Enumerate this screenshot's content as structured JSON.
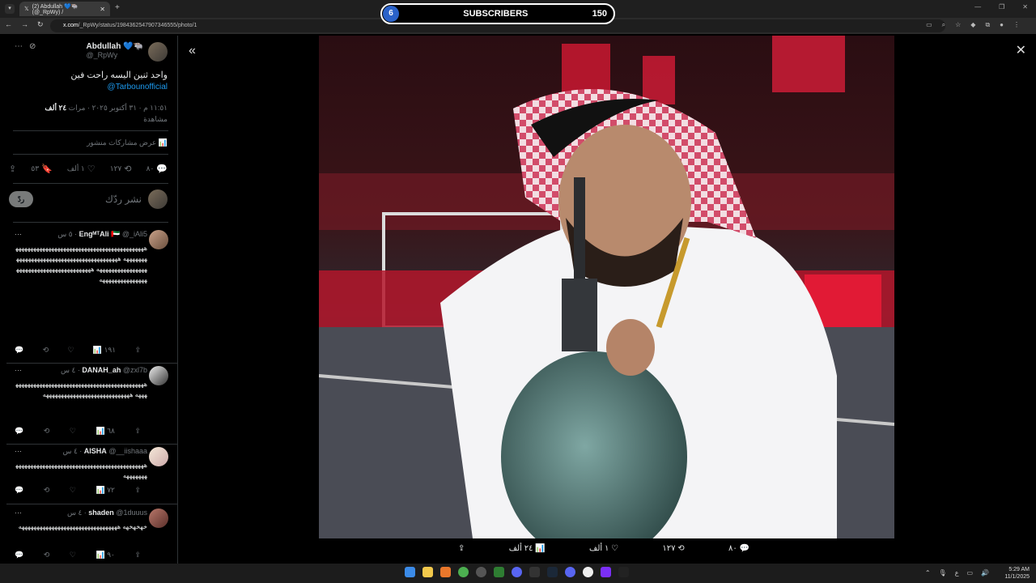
{
  "browser": {
    "tab_title": "(2) Abdullah 💙🐃 (@_RpWy) /",
    "tab_menu_icon": "chevron-down-icon",
    "new_tab": "+",
    "url_host": "x.com",
    "url_path": "/_RpWy/status/1984362547907346555/photo/1"
  },
  "overlay": {
    "count": "6",
    "label": "SUBSCRIBERS",
    "goal": "150",
    "accent": "#2a62c9"
  },
  "post": {
    "author": "Abdullah 💙🐃",
    "handle": "@_RpWy",
    "text": "واحد ثنين اليسه راحت فين",
    "mention": "@Tarbounofficial",
    "time_line": "١١:٥١ م · ٣١ أكتوبر ٢٠٢٥ · مرات",
    "views_count": "٢٤ ألف",
    "views_label": "مشاهدة",
    "engagements": "عرض مشاركات منشور",
    "actions": {
      "replies": "٨٠",
      "reposts": "١٢٧",
      "likes": "١ ألف",
      "bookmarks": "٥٣"
    },
    "reply_placeholder": "نشر ردّك",
    "reply_button": "ردّ"
  },
  "comments": [
    {
      "name": "EngᴹᵀAli 🇦🇪",
      "handle": "@_iAli5",
      "time": "٥ س",
      "text": "هههههههههههههههههههههههههههههههههههههههههههههههههههه هههههههههههههههههههههههههههههههههههههههههههههههههههه هههههههههههههههههههههههههههههههههههههههههه",
      "views": "١٩١"
    },
    {
      "name": "DANAH_ah",
      "handle": "@zxl7b",
      "time": "٤ س",
      "text": "هههههههههههههههههههههههههههههههههههههههههههههههه هههههههههههههههههههههههههههههه",
      "views": "٦٨"
    },
    {
      "name": "AISHA",
      "handle": "@__iishaaa",
      "time": "٤ س",
      "text": "هههههههههههههههههههههههههههههههههههههههههههههههههههه",
      "views": "٧٢"
    },
    {
      "name": "shaden",
      "handle": "@1duuus",
      "time": "٤ س",
      "text": "خهخهخهه هههههههههههههههههههههههههههههههههه",
      "views": "٩٠"
    }
  ],
  "photo_actions": {
    "replies": "٨٠",
    "reposts": "١٢٧",
    "likes": "١ ألف",
    "views": "٢٤ ألف"
  },
  "taskbar": {
    "time": "5:29 AM",
    "date": "11/1/2025",
    "lang": "ع"
  }
}
